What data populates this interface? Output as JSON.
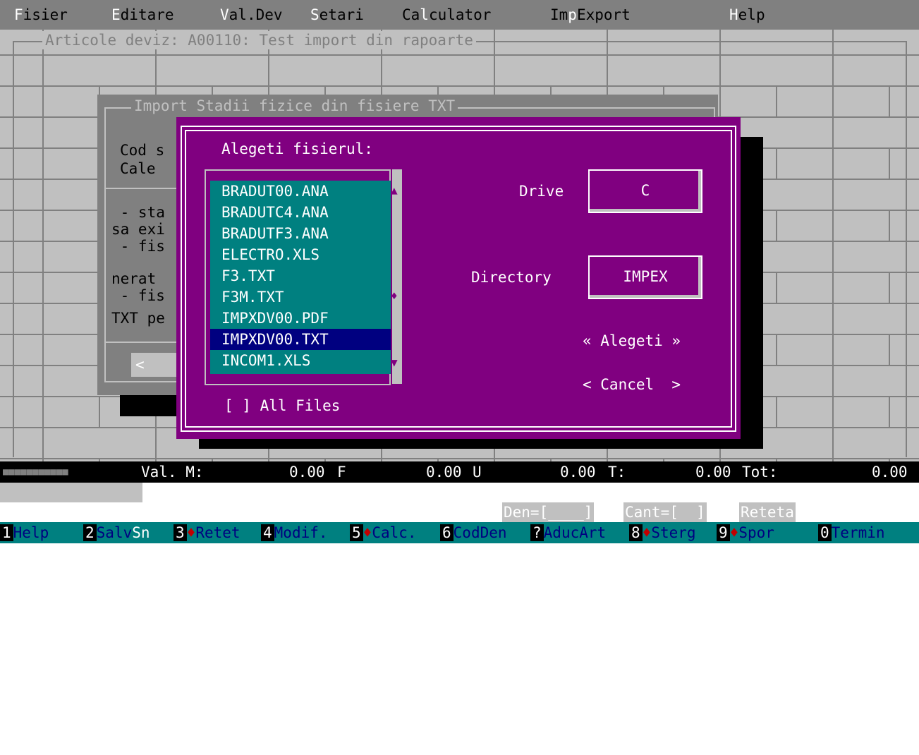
{
  "menu": [
    {
      "hot": "F",
      "rest": "isier"
    },
    {
      "hot": "E",
      "rest": "ditare"
    },
    {
      "hot": "V",
      "rest": "al.Dev"
    },
    {
      "hot": "S",
      "rest": "etari"
    },
    {
      "pre": "Ca",
      "hot": "l",
      "rest": "culator"
    },
    {
      "pre": "Im",
      "hot": "p",
      "rest": "Export"
    },
    {
      "hot": "H",
      "rest": "elp"
    }
  ],
  "articles_window": {
    "title": "Articole deviz: A00110: Test import din rapoarte"
  },
  "import_dialog": {
    "title": "Import Stadii fizice din fisiere TXT",
    "lines": [
      "Cod s",
      "Cale",
      " - sta",
      "sa exi",
      " - fis",
      "nerat",
      " - fis",
      "TXT pe"
    ],
    "button": "<"
  },
  "file_dialog": {
    "prompt": "Alegeti fisierul:",
    "files": [
      "BRADUT00.ANA",
      "BRADUTC4.ANA",
      "BRADUTF3.ANA",
      "ELECTRO.XLS",
      "F3.TXT",
      "F3M.TXT",
      "IMPXDV00.PDF",
      "IMPXDV00.TXT",
      "INCOM1.XLS"
    ],
    "selected_index": 7,
    "drive_label": "Drive",
    "drive_value": "C",
    "directory_label": "Directory",
    "directory_value": "IMPEX",
    "choose_button": "« Alegeti »",
    "cancel_button": "< Cancel  >",
    "all_files_checkbox": "[ ] All Files",
    "scroll_arrows": {
      "up": "▲",
      "thumb": "♦",
      "down": "▼"
    }
  },
  "status": {
    "progress_blocks": "■■■■■■■■■■■",
    "val_label": "Val. M:",
    "m_value": "0.00",
    "f_label": "F",
    "f_value": "0.00",
    "u_label": "U",
    "u_value": "0.00",
    "t_label": "T:",
    "t_value": "0.00",
    "tot_label": "Tot:",
    "tot_value": "0.00"
  },
  "hints": {
    "den": "Den=[____]",
    "cant": "Cant=[  ]",
    "reteta": "Reteta"
  },
  "function_keys": [
    {
      "key": "1",
      "label": "Help",
      "diamond": false
    },
    {
      "key": "2",
      "label": "Salv",
      "extra": "Sn",
      "diamond": false
    },
    {
      "key": "3",
      "label": "Retet",
      "diamond": true
    },
    {
      "key": "4",
      "label": "Modif.",
      "diamond": false
    },
    {
      "key": "5",
      "label": "Calc.",
      "diamond": true
    },
    {
      "key": "6",
      "label": "CodDen",
      "diamond": false
    },
    {
      "key": "?",
      "label": "AducArt",
      "diamond": false
    },
    {
      "key": "8",
      "label": "Sterg",
      "diamond": true
    },
    {
      "key": "9",
      "label": "Spor",
      "diamond": true
    },
    {
      "key": "0",
      "label": "Termin",
      "diamond": false
    }
  ],
  "colors": {
    "dialog_bg": "#800080",
    "list_bg": "#008080",
    "selection": "#000080",
    "desktop": "#c0c0c0"
  }
}
